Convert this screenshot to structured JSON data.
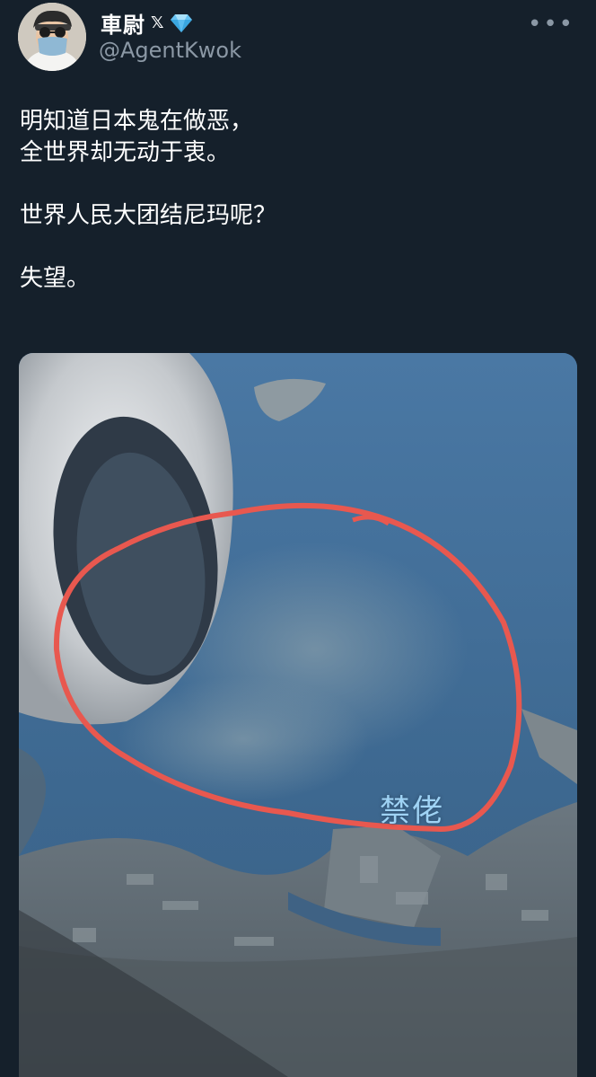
{
  "user": {
    "display_name": "車尉",
    "x_badge": "𝕏",
    "verified_icon": "diamond-icon",
    "handle": "@AgentKwok"
  },
  "more_icon": "more-options-icon",
  "tweet": {
    "lines": [
      "明知道日本鬼在做恶，",
      "全世界却无动于衷。",
      "",
      "世界人民大团结尼玛呢？",
      "",
      "失望。"
    ]
  },
  "media": {
    "overlay_text": "禁佬",
    "highlight_color": "#e8584f",
    "water_color": "#3c6b93"
  }
}
